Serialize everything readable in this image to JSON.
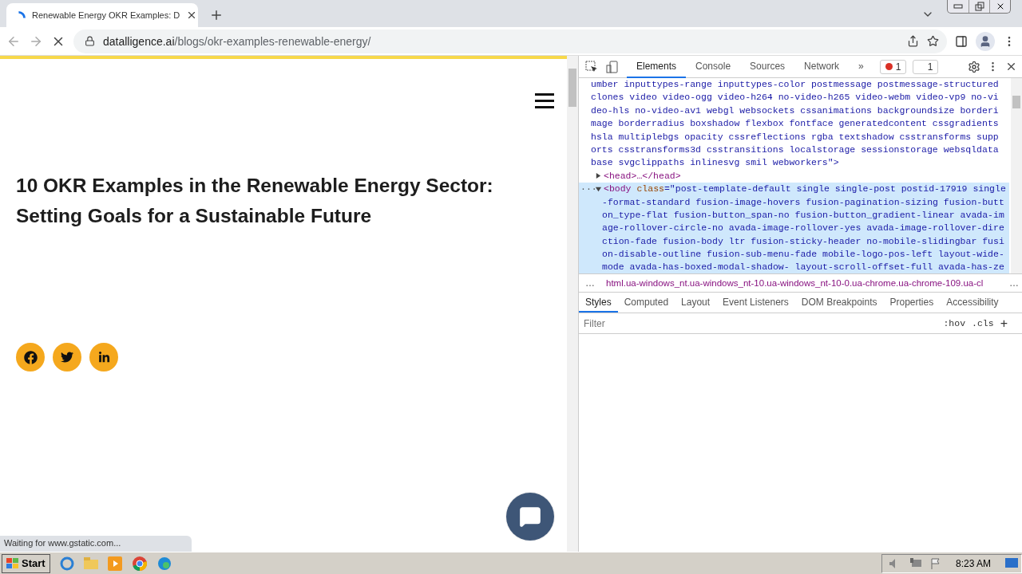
{
  "browser": {
    "tab": {
      "title": "Renewable Energy OKR Examples: D",
      "loading": true
    },
    "address": {
      "domain": "datalligence.ai",
      "path": "/blogs/okr-examples-renewable-energy/"
    },
    "status": "Waiting for www.gstatic.com..."
  },
  "page": {
    "heading": "10 OKR Examples in the Renewable Energy Sector: Setting Goals for a Sustainable Future",
    "share_buttons": [
      {
        "kind": "facebook"
      },
      {
        "kind": "twitter"
      },
      {
        "kind": "linkedin"
      }
    ]
  },
  "devtools": {
    "tabs": [
      {
        "label": "Elements",
        "selected": true
      },
      {
        "label": "Console",
        "selected": false
      },
      {
        "label": "Sources",
        "selected": false
      },
      {
        "label": "Network",
        "selected": false
      }
    ],
    "more": "»",
    "errors": "1",
    "issues": "1",
    "text_lines": [
      "umber inputtypes-range inputtypes-color postmessage postmessage-structured",
      "clones video video-ogg video-h264 no-video-h265 video-webm video-vp9 no-vi",
      "deo-hls no-video-av1 webgl websockets cssanimations backgroundsize borderi",
      "mage borderradius boxshadow flexbox fontface generatedcontent cssgradients",
      "hsla multiplebgs opacity cssreflections rgba textshadow csstransforms supp",
      "orts csstransforms3d csstransitions localstorage sessionstorage websqldata",
      "base svgclippaths inlinesvg smil webworkers\">"
    ],
    "nodes": [
      {
        "text": "<head>…</head>",
        "expanded": false,
        "selected": false
      },
      {
        "marker": "···",
        "tag": "<body",
        "attr": "class",
        "expanded": true,
        "selected": true,
        "lines": [
          "=\"post-template-default single single-post postid-17919 single",
          "-format-standard fusion-image-hovers fusion-pagination-sizing fusion-butt",
          "on_type-flat fusion-button_span-no fusion-button_gradient-linear avada-im",
          "age-rollover-circle-no avada-image-rollover-yes avada-image-rollover-dire",
          "ction-fade fusion-body ltr fusion-sticky-header no-mobile-slidingbar fusi",
          "on-disable-outline fusion-sub-menu-fade mobile-logo-pos-left layout-wide-",
          "mode avada-has-boxed-modal-shadow- layout-scroll-offset-full avada-has-ze"
        ]
      }
    ],
    "breadcrumb_left": "…",
    "breadcrumb_right": "…",
    "breadcrumb": "html.ua-windows_nt.ua-windows_nt-10.ua-windows_nt-10-0.ua-chrome.ua-chrome-109.ua-cl",
    "subtabs": [
      {
        "label": "Styles",
        "selected": true
      },
      {
        "label": "Computed",
        "selected": false
      },
      {
        "label": "Layout",
        "selected": false
      },
      {
        "label": "Event Listeners",
        "selected": false
      },
      {
        "label": "DOM Breakpoints",
        "selected": false
      },
      {
        "label": "Properties",
        "selected": false
      },
      {
        "label": "Accessibility",
        "selected": false
      }
    ],
    "filter": {
      "placeholder": "Filter"
    },
    "hov": ":hov",
    "cls": ".cls",
    "add": "+"
  },
  "taskbar": {
    "start": "Start",
    "clock": "8:23 AM"
  }
}
